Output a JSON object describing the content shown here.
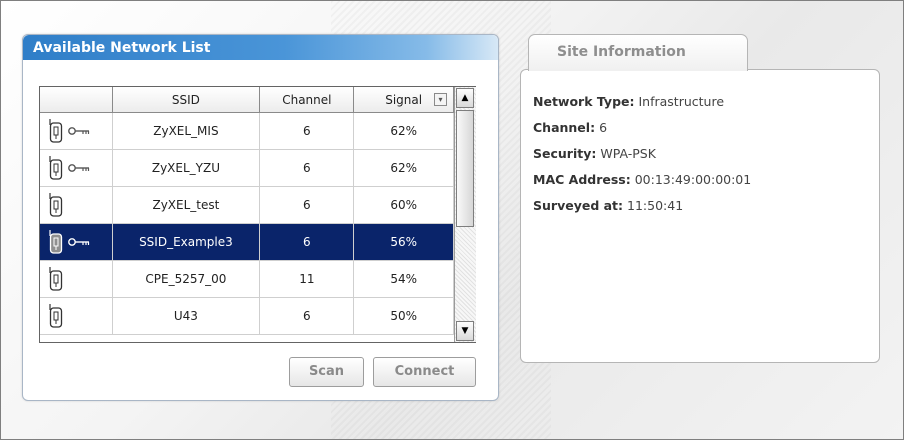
{
  "network_list": {
    "title": "Available Network List",
    "columns": [
      "",
      "SSID",
      "Channel",
      "Signal"
    ],
    "rows": [
      {
        "ssid": "ZyXEL_MIS",
        "channel": "6",
        "signal": "62%",
        "secured": true,
        "selected": false
      },
      {
        "ssid": "ZyXEL_YZU",
        "channel": "6",
        "signal": "62%",
        "secured": true,
        "selected": false
      },
      {
        "ssid": "ZyXEL_test",
        "channel": "6",
        "signal": "60%",
        "secured": false,
        "selected": false
      },
      {
        "ssid": "SSID_Example3",
        "channel": "6",
        "signal": "56%",
        "secured": true,
        "selected": true
      },
      {
        "ssid": "CPE_5257_00",
        "channel": "11",
        "signal": "54%",
        "secured": false,
        "selected": false
      },
      {
        "ssid": "U43",
        "channel": "6",
        "signal": "50%",
        "secured": false,
        "selected": false
      }
    ],
    "scan_label": "Scan",
    "connect_label": "Connect",
    "icons": {
      "ap": "access-point-icon",
      "key": "key-icon",
      "sort": "sort-dropdown-icon"
    }
  },
  "site_info": {
    "tab_label": "Site Information",
    "network_type_label": "Network Type:",
    "network_type_value": "Infrastructure",
    "channel_label": "Channel:",
    "channel_value": "6",
    "security_label": "Security:",
    "security_value": "WPA-PSK",
    "mac_label": "MAC Address:",
    "mac_value": "00:13:49:00:00:01",
    "surveyed_label": "Surveyed at:",
    "surveyed_value": "11:50:41"
  },
  "colors": {
    "header_blue": "#2f7ec8",
    "selected_row": "#0a246a",
    "disabled_button_text": "#8a8a8a"
  }
}
